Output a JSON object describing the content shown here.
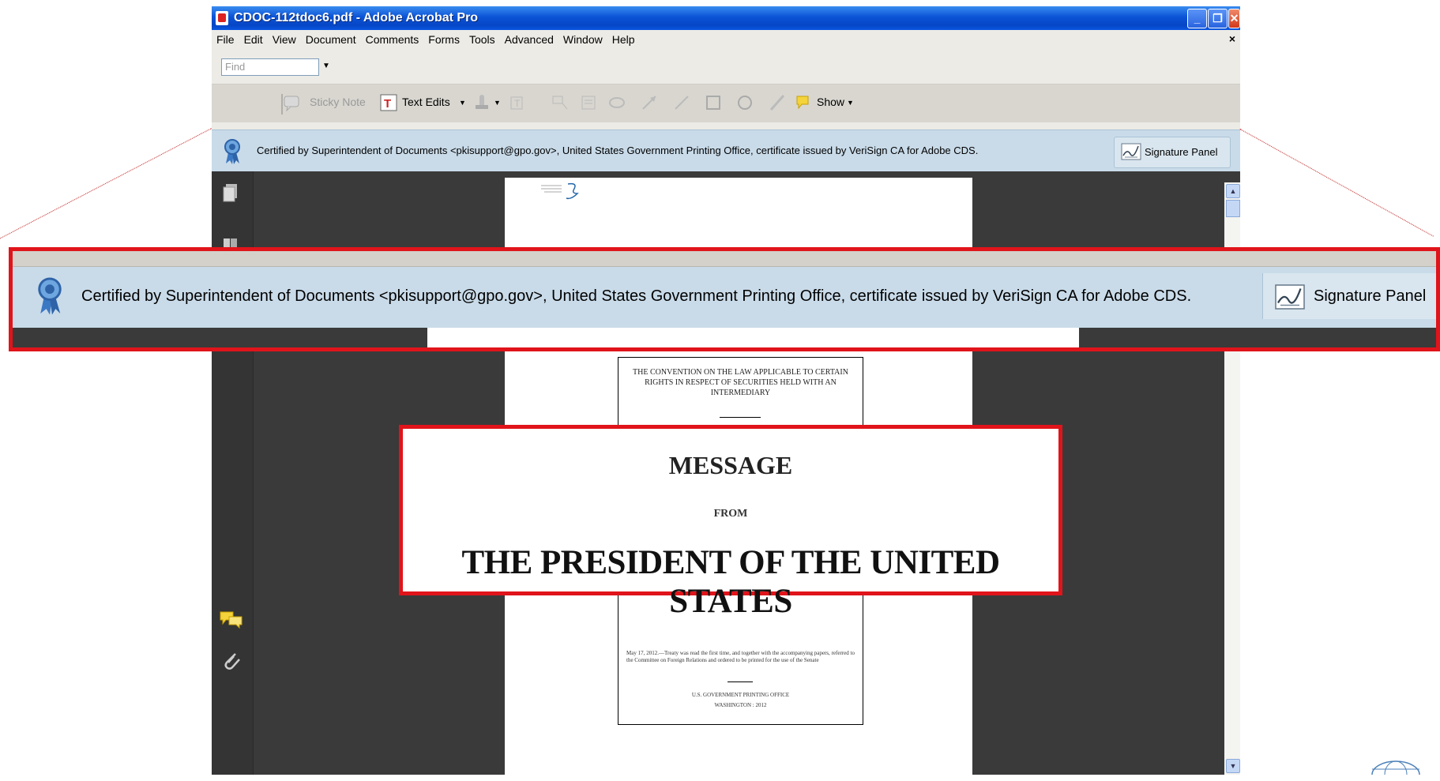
{
  "window": {
    "title": "CDOC-112tdoc6.pdf - Adobe Acrobat Pro",
    "buttons": {
      "minimize": "_",
      "restore": "❐",
      "close": "✕"
    }
  },
  "menu": {
    "items": [
      "File",
      "Edit",
      "View",
      "Document",
      "Comments",
      "Forms",
      "Tools",
      "Advanced",
      "Window",
      "Help"
    ],
    "close_glyph": "×"
  },
  "find": {
    "placeholder": "Find"
  },
  "toolbar": {
    "sticky_note": "Sticky Note",
    "text_edits": "Text Edits",
    "show": "Show"
  },
  "certification": {
    "text": "Certified by Superintendent of Documents <pkisupport@gpo.gov>, United States Government Printing Office, certificate issued by VeriSign CA for Adobe CDS.",
    "signature_panel": "Signature Panel"
  },
  "document": {
    "cover_title": "THE CONVENTION ON THE LAW APPLICABLE TO CERTAIN RIGHTS IN RESPECT OF SECURITIES HELD WITH AN INTERMEDIARY",
    "message": "MESSAGE",
    "from": "FROM",
    "president": "THE PRESIDENT OF THE UNITED STATES",
    "treaty_note": "May 17, 2012.—Treaty was read the first time, and together with the accompanying papers, referred to the Committee on Foreign Relations and ordered to be printed for the use of the Senate",
    "printer": "U.S. GOVERNMENT PRINTING OFFICE",
    "location": "WASHINGTON : 2012"
  },
  "colors": {
    "highlight_border": "#e0141a",
    "cert_bar": "#c9dbe9",
    "title_bar": "#0a53d6"
  },
  "icons": [
    "pdf-icon",
    "certified-ribbon-icon",
    "signature-pen-icon",
    "pages-icon",
    "bookmarks-icon",
    "comments-icon",
    "attachment-icon",
    "sticky-note-icon",
    "text-edits-icon",
    "stamp-icon",
    "show-comments-icon"
  ]
}
